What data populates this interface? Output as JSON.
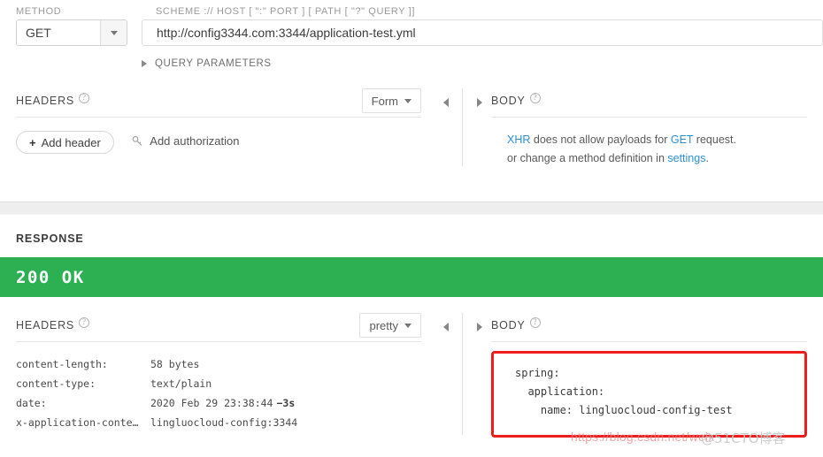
{
  "request": {
    "method_label": "METHOD",
    "url_label": "SCHEME :// HOST [ \":\" PORT ] [ PATH [ \"?\" QUERY ]]",
    "method_value": "GET",
    "url_value": "http://config3344.com:3344/application-test.yml",
    "query_parameters_label": "QUERY PARAMETERS",
    "headers_panel": {
      "title": "HEADERS",
      "format_select": "Form",
      "add_header_button": "Add header",
      "add_authorization_button": "Add authorization"
    },
    "body_panel": {
      "title": "BODY",
      "message_line1_pre": "",
      "message_xhr": "XHR",
      "message_mid": " does not allow payloads for ",
      "message_get": "GET",
      "message_end": " request.",
      "message_line2_pre": "or change a method definition in ",
      "message_settings": "settings",
      "message_line2_end": "."
    }
  },
  "response": {
    "section_label": "RESPONSE",
    "status": "200 OK",
    "status_color": "#2cb052",
    "headers_panel": {
      "title": "HEADERS",
      "format_select": "pretty",
      "rows": [
        {
          "name": "content-length:",
          "value": "58 bytes"
        },
        {
          "name": "content-type:",
          "value": "text/plain"
        },
        {
          "name": "date:",
          "value": "2020 Feb 29 23:38:44",
          "badge": "−3s"
        },
        {
          "name": "x-application-conte…",
          "value": "lingluocloud-config:3344"
        }
      ]
    },
    "body_panel": {
      "title": "BODY",
      "highlight_color": "#ee1c1c",
      "content": "spring:\n  application:\n    name: lingluocloud-config-test"
    }
  },
  "watermark": {
    "url": "https://blog.csdn.net/weix",
    "brand": "@51CTO博客"
  },
  "icons": {
    "help": "?",
    "plus": "+",
    "caret_down": "▾",
    "triangle_right": "▸",
    "triangle_left": "◂"
  }
}
